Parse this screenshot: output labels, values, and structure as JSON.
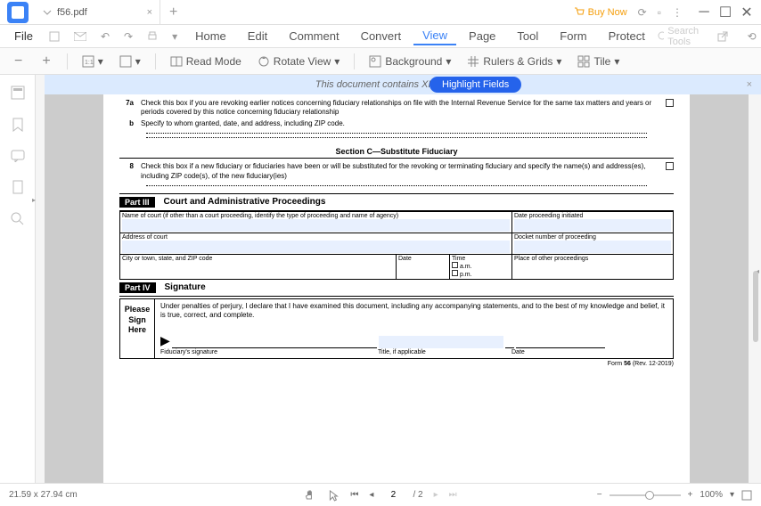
{
  "tab": {
    "filename": "f56.pdf"
  },
  "titlebar": {
    "buy_now": "Buy Now"
  },
  "menu": {
    "file": "File",
    "items": [
      "Home",
      "Edit",
      "Comment",
      "Convert",
      "View",
      "Page",
      "Tool",
      "Form",
      "Protect"
    ],
    "active_index": 4,
    "search_placeholder": "Search Tools"
  },
  "toolbar": {
    "read_mode": "Read Mode",
    "rotate_view": "Rotate View",
    "background": "Background",
    "rulers_grids": "Rulers & Grids",
    "tile": "Tile"
  },
  "banner": {
    "text": "This document contains XFA form fields.",
    "button": "Highlight Fields"
  },
  "form": {
    "line7a_num": "7a",
    "line7a_text": "Check this box if you are revoking earlier notices concerning fiduciary relationships on file with the Internal Revenue Service for the same tax matters and years or periods covered by this notice concerning fiduciary relationship",
    "line_b_num": "b",
    "line_b_text": "Specify to whom granted, date, and address, including ZIP code.",
    "section_c": "Section C—Substitute Fiduciary",
    "line8_num": "8",
    "line8_text": "Check this box if a new fiduciary or fiduciaries have been or will be substituted for the revoking or terminating fiduciary and specify the name(s) and address(es), including ZIP code(s), of the new fiduciary(ies)",
    "part3_label": "Part III",
    "part3_title": "Court and Administrative Proceedings",
    "court_name": "Name of court (if other than a court proceeding, identify the type of proceeding and name of agency)",
    "date_initiated": "Date proceeding initiated",
    "court_address": "Address of court",
    "docket": "Docket number of proceeding",
    "city_state": "City or town, state, and ZIP code",
    "date": "Date",
    "time": "Time",
    "am": "a.m.",
    "pm": "p.m.",
    "place_other": "Place of other proceedings",
    "part4_label": "Part IV",
    "part4_title": "Signature",
    "please_sign": "Please Sign Here",
    "perjury": "Under penalties of perjury, I declare that I have examined this document, including any accompanying statements, and to the best of my knowledge and belief, it is true, correct, and complete.",
    "fid_sig": "Fiduciary's signature",
    "title_if": "Title, if applicable",
    "sig_date": "Date",
    "footer_form": "Form",
    "footer_num": "56",
    "footer_rev": "(Rev. 12-2019)"
  },
  "status": {
    "dimensions": "21.59 x 27.94 cm",
    "current_page": "2",
    "total_pages": "/ 2",
    "zoom": "100%"
  }
}
